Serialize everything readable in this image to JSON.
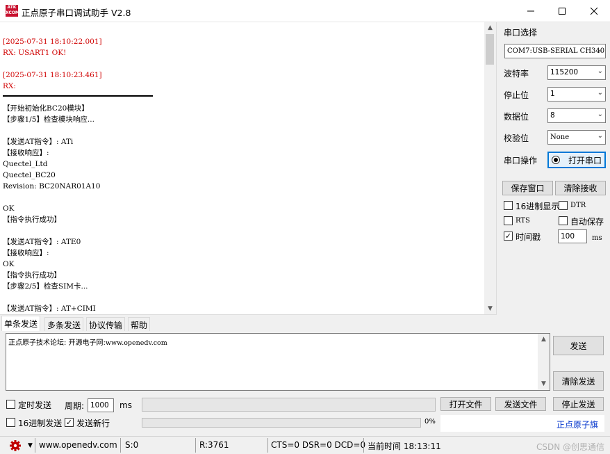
{
  "window": {
    "title": "正点原子串口调试助手 V2.8",
    "logo_text": "ATK\nXCOM"
  },
  "output": {
    "lines": [
      {
        "text": "[2025-07-31 18:10:22.001]",
        "color": "#d00000"
      },
      {
        "text": "RX: USART1 OK!",
        "color": "#d00000",
        "rx": true
      },
      {
        "text": ""
      },
      {
        "text": "[2025-07-31 18:10:23.461]",
        "color": "#d00000"
      },
      {
        "text": "RX:",
        "color": "#d00000",
        "rx": true
      },
      {
        "separator": true
      },
      {
        "text": "【开始初始化BC20模块】"
      },
      {
        "text": "【步骤1/5】检查模块响应..."
      },
      {
        "text": ""
      },
      {
        "text": "【发送AT指令】: ATi"
      },
      {
        "text": "【接收响应】:"
      },
      {
        "text": "Quectel_Ltd"
      },
      {
        "text": "Quectel_BC20"
      },
      {
        "text": "Revision: BC20NAR01A10"
      },
      {
        "text": ""
      },
      {
        "text": "OK"
      },
      {
        "text": "【指令执行成功】"
      },
      {
        "text": ""
      },
      {
        "text": "【发送AT指令】: ATE0"
      },
      {
        "text": "【接收响应】:"
      },
      {
        "text": "OK"
      },
      {
        "text": "【指令执行成功】"
      },
      {
        "text": "【步骤2/5】检查SIM卡..."
      },
      {
        "text": ""
      },
      {
        "text": "【发送AT指令】: AT+CIMI"
      }
    ]
  },
  "panel": {
    "port_label": "串口选择",
    "port_value": "COM7:USB-SERIAL CH340",
    "baud_label": "波特率",
    "baud_value": "115200",
    "stop_label": "停止位",
    "stop_value": "1",
    "data_label": "数据位",
    "data_value": "8",
    "parity_label": "校验位",
    "parity_value": "None",
    "op_label": "串口操作",
    "open_button": "打开串口",
    "save_window": "保存窗口",
    "clear_receive": "清除接收",
    "hex_display": "16进制显示",
    "dtr": "DTR",
    "rts": "RTS",
    "auto_save": "自动保存",
    "timestamp": "时间戳",
    "timestamp_value": "100",
    "ms": "ms",
    "checks": {
      "hex_display": false,
      "dtr": false,
      "rts": false,
      "auto_save": false,
      "timestamp": true
    }
  },
  "tabs": [
    {
      "label": "单条发送",
      "active": true
    },
    {
      "label": "多条发送",
      "active": false
    },
    {
      "label": "协议传输",
      "active": false
    },
    {
      "label": "帮助",
      "active": false
    }
  ],
  "send": {
    "text_cn": "正点原子技术论坛: 开源电子网:",
    "text_url": "www.openedv.com",
    "send_button": "发送",
    "clear_send_button": "清除发送"
  },
  "controls": {
    "timed_send": "定时发送",
    "period_label": "周期:",
    "period_value": "1000",
    "ms": "ms",
    "open_file": "打开文件",
    "send_file": "发送文件",
    "stop_send": "停止发送",
    "hex_send": "16进制发送",
    "send_newline": "发送新行",
    "progress": "0%",
    "progress_value": 0,
    "brand_link": "正点原子旗",
    "checks": {
      "timed_send": false,
      "hex_send": false,
      "send_newline": true
    }
  },
  "status": {
    "website": "www.openedv.com",
    "sent": "S:0",
    "received": "R:3761",
    "lines": "CTS=0 DSR=0 DCD=0",
    "time": "当前时间 18:13:11",
    "watermark": "CSDN @创思通信"
  },
  "colors": {
    "accent": "#0078d7",
    "rx": "#d00000",
    "brand_link": "#0033cc",
    "gear": "#c00000"
  }
}
